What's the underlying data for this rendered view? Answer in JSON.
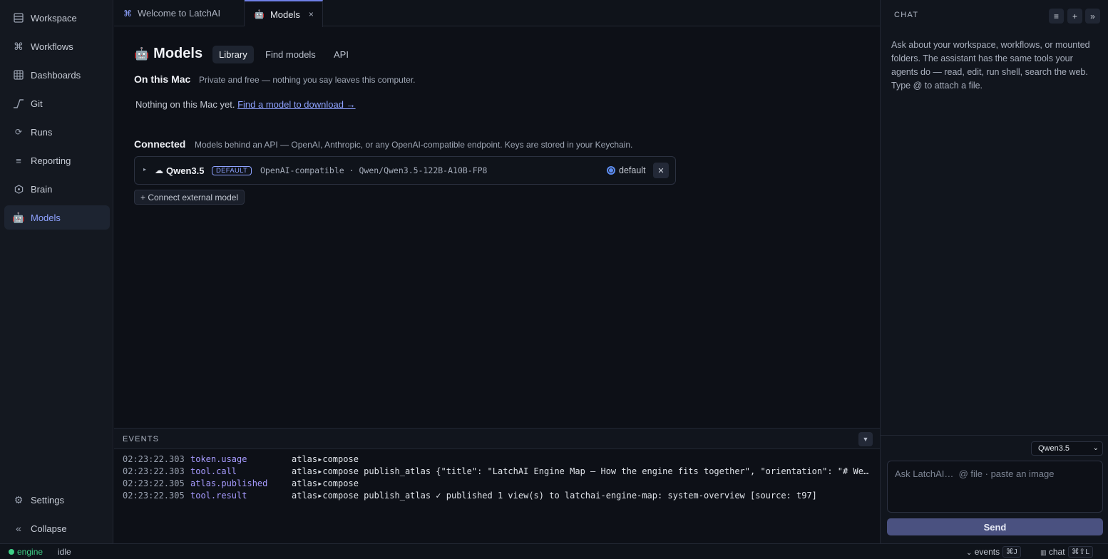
{
  "sidebar": {
    "items": [
      {
        "label": "Workspace",
        "icon": "workspace-icon"
      },
      {
        "label": "Workflows",
        "icon": "command-icon"
      },
      {
        "label": "Dashboards",
        "icon": "grid-icon"
      },
      {
        "label": "Git",
        "icon": "git-icon"
      },
      {
        "label": "Runs",
        "icon": "refresh-icon"
      },
      {
        "label": "Reporting",
        "icon": "list-icon"
      },
      {
        "label": "Brain",
        "icon": "brain-icon"
      },
      {
        "label": "Models",
        "icon": "robot-icon",
        "active": true
      }
    ],
    "settings_label": "Settings",
    "collapse_label": "Collapse"
  },
  "tabs": [
    {
      "label": "Welcome to LatchAI",
      "icon": "command-icon"
    },
    {
      "label": "Models",
      "icon": "robot-icon",
      "active": true,
      "close": "×"
    }
  ],
  "main": {
    "title": "Models",
    "subtabs": [
      "Library",
      "Find models",
      "API"
    ],
    "on_mac": {
      "heading": "On this Mac",
      "subtitle": "Private and free — nothing you say leaves this computer.",
      "empty_text": "Nothing on this Mac yet.",
      "empty_link": "Find a model to download →"
    },
    "connected": {
      "heading": "Connected",
      "subtitle": "Models behind an API — OpenAI, Anthropic, or any OpenAI-compatible endpoint. Keys are stored in your Keychain.",
      "models": [
        {
          "name": "Qwen3.5",
          "badge": "DEFAULT",
          "description": "OpenAI-compatible · Qwen/Qwen3.5-122B-A10B-FP8",
          "default_label": "default",
          "is_default": true
        }
      ],
      "connect_button": "+ Connect external model"
    }
  },
  "events": {
    "title": "EVENTS",
    "rows": [
      {
        "ts": "02:23:22.303",
        "type": "token.usage",
        "msg": "atlas▸compose"
      },
      {
        "ts": "02:23:22.303",
        "type": "tool.call",
        "msg": "atlas▸compose publish_atlas {\"title\": \"LatchAI Engine Map — How the engine fits together\", \"orientation\": \"# Welcome…"
      },
      {
        "ts": "02:23:22.305",
        "type": "atlas.published",
        "msg": "atlas▸compose"
      },
      {
        "ts": "02:23:22.305",
        "type": "tool.result",
        "msg": "atlas▸compose publish_atlas ✓ published 1 view(s) to latchai-engine-map: system-overview [source: t97]"
      }
    ]
  },
  "chat": {
    "title": "CHAT",
    "intro": "Ask about your workspace, workflows, or mounted folders. The assistant has the same tools your agents do — read, edit, run shell, search the web. Type @ to attach a file.",
    "model_selected": "Qwen3.5",
    "input_placeholder": "Ask LatchAI…  @ file · paste an image",
    "send_label": "Send"
  },
  "statusbar": {
    "engine_label": "engine",
    "engine_color": "#3ecf86",
    "state": "idle",
    "events_label": "events",
    "events_shortcut": "⌘J",
    "chat_label": "chat",
    "chat_shortcut": "⌘⇧L"
  },
  "colors": {
    "accent": "#8ea2ff",
    "background": "#0d1017",
    "sidebar": "#141820"
  }
}
